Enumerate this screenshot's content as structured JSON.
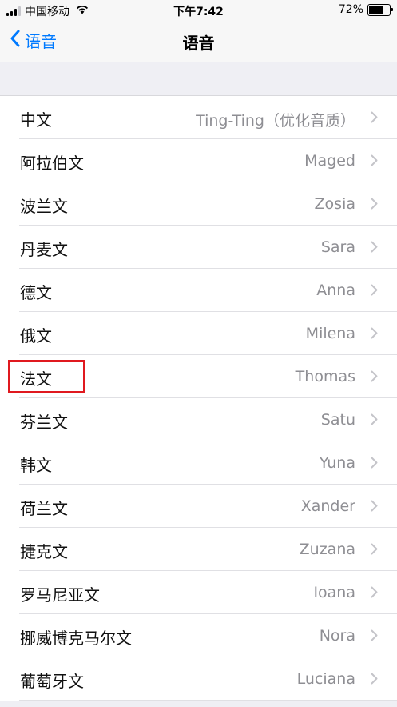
{
  "status_bar": {
    "carrier": "中国移动",
    "time": "下午7:42",
    "battery_percent": "72%",
    "battery_level": 0.72
  },
  "nav": {
    "back_label": "语音",
    "title": "语音"
  },
  "voices": [
    {
      "language": "中文",
      "voice": "Ting-Ting（优化音质）"
    },
    {
      "language": "阿拉伯文",
      "voice": "Maged"
    },
    {
      "language": "波兰文",
      "voice": "Zosia"
    },
    {
      "language": "丹麦文",
      "voice": "Sara"
    },
    {
      "language": "德文",
      "voice": "Anna"
    },
    {
      "language": "俄文",
      "voice": "Milena"
    },
    {
      "language": "法文",
      "voice": "Thomas"
    },
    {
      "language": "芬兰文",
      "voice": "Satu"
    },
    {
      "language": "韩文",
      "voice": "Yuna"
    },
    {
      "language": "荷兰文",
      "voice": "Xander"
    },
    {
      "language": "捷克文",
      "voice": "Zuzana"
    },
    {
      "language": "罗马尼亚文",
      "voice": "Ioana"
    },
    {
      "language": "挪威博克马尔文",
      "voice": "Nora"
    },
    {
      "language": "葡萄牙文",
      "voice": "Luciana"
    }
  ],
  "colors": {
    "accent": "#007aff",
    "highlight": "#e0191f",
    "secondary_text": "#8e8e93"
  }
}
